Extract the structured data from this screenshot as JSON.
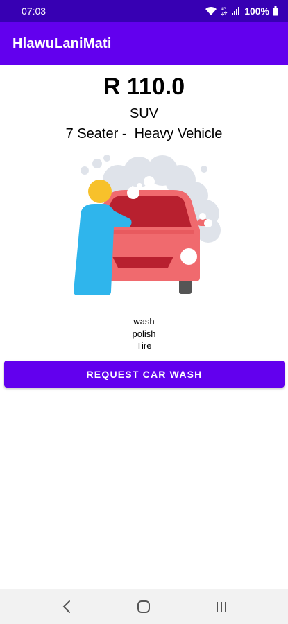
{
  "status_bar": {
    "time": "07:03",
    "battery": "100%",
    "icons": [
      "wifi-icon",
      "volte-icon",
      "signal-icon",
      "battery-icon"
    ]
  },
  "app_bar": {
    "title": "HlawuLaniMati"
  },
  "main": {
    "price": "R 110.0",
    "vehicle_type": "SUV",
    "vehicle_description": "7 Seater -  Heavy Vehicle",
    "illustration": "car-wash-illustration",
    "services": [
      "wash",
      "polish",
      "Tire"
    ],
    "request_button_label": "REQUEST CAR WASH"
  },
  "nav_bar": {
    "icons": [
      "back-icon",
      "home-icon",
      "recents-icon"
    ]
  },
  "colors": {
    "status_bar": "#3700b3",
    "primary": "#6200ee",
    "car_body": "#f06a6e",
    "car_dark": "#b8202f",
    "person_skin": "#f7c12b",
    "person_shirt": "#2fb5ec",
    "suds": "#dfe3ea"
  }
}
